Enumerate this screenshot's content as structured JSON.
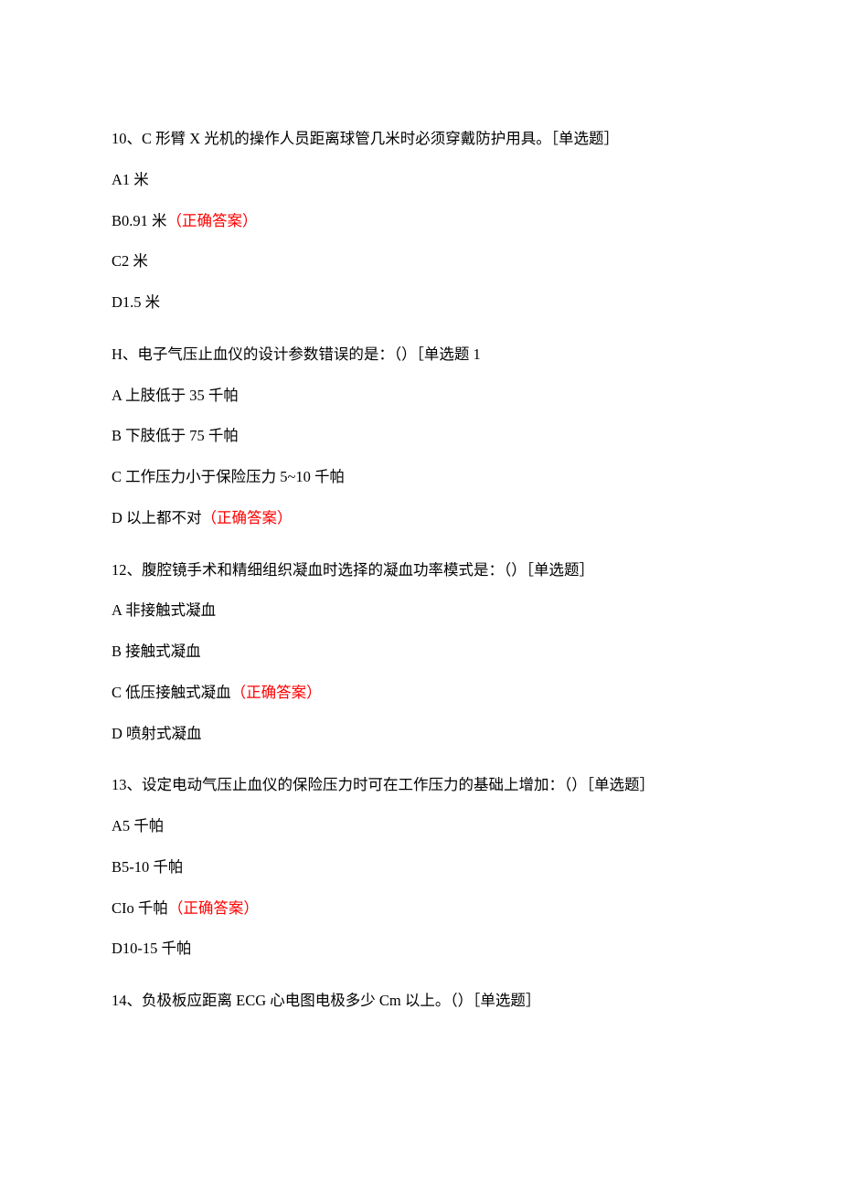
{
  "questions": [
    {
      "stem": "10、C 形臂 X 光机的操作人员距离球管几米时必须穿戴防护用具。［单选题］",
      "options": [
        {
          "pre": "A1 米",
          "correct": ""
        },
        {
          "pre": "B0.91 米",
          "correct": "（正确答案）"
        },
        {
          "pre": "C2 米",
          "correct": ""
        },
        {
          "pre": "D1.5 米",
          "correct": ""
        }
      ]
    },
    {
      "stem": "H、电子气压止血仪的设计参数错误的是：（）［单选题 1",
      "options": [
        {
          "pre": "A 上肢低于 35 千帕",
          "correct": ""
        },
        {
          "pre": "B 下肢低于 75 千帕",
          "correct": ""
        },
        {
          "pre": "C 工作压力小于保险压力 5~10 千帕",
          "correct": ""
        },
        {
          "pre": "D 以上都不对",
          "correct": "（正确答案）"
        }
      ]
    },
    {
      "stem": "12、腹腔镜手术和精细组织凝血时选择的凝血功率模式是：（）［单选题］",
      "options": [
        {
          "pre": "A 非接触式凝血",
          "correct": ""
        },
        {
          "pre": "B 接触式凝血",
          "correct": ""
        },
        {
          "pre": "C 低压接触式凝血",
          "correct": "（正确答案）"
        },
        {
          "pre": "D 喷射式凝血",
          "correct": ""
        }
      ]
    },
    {
      "stem": "13、设定电动气压止血仪的保险压力时可在工作压力的基础上增加：（）［单选题］",
      "options": [
        {
          "pre": "A5 千帕",
          "correct": ""
        },
        {
          "pre": "B5-10 千帕",
          "correct": ""
        },
        {
          "pre": "CIo 千帕",
          "correct": "（正确答案）"
        },
        {
          "pre": "D10-15 千帕",
          "correct": ""
        }
      ]
    },
    {
      "stem": "14、负极板应距离 ECG 心电图电极多少 Cm 以上。（）［单选题］",
      "options": []
    }
  ]
}
